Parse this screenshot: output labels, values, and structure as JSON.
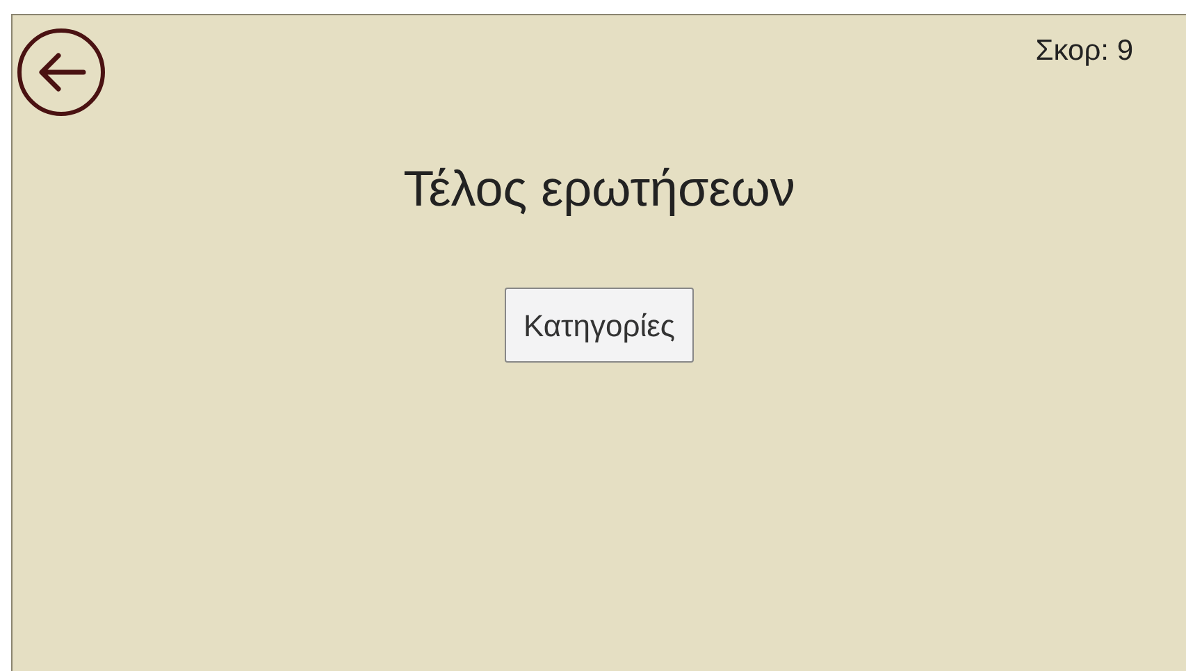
{
  "score": "Σκορ: 9",
  "title": "Τέλος ερωτήσεων",
  "buttons": [
    {
      "label": "Κατηγορίες"
    }
  ]
}
